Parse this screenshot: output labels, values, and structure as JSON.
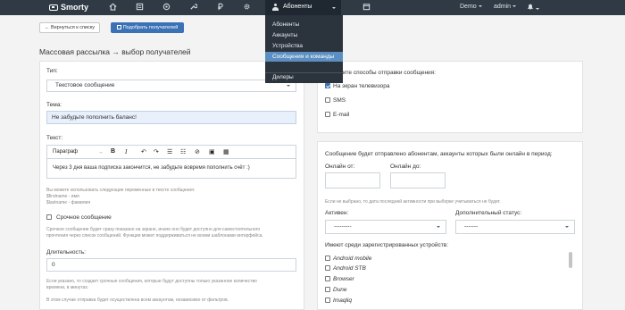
{
  "navbar": {
    "brand": "Smorty",
    "active_menu": "Абоненты",
    "demo": "Demo",
    "admin": "admin",
    "icons": [
      "home-icon",
      "list-icon",
      "eye-icon",
      "wrench-icon",
      "ruble-icon",
      "gear-icon",
      "calendar-icon",
      "bell-icon"
    ]
  },
  "dropdown": {
    "items": [
      "Абоненты",
      "Аккаунты",
      "Устройства",
      "Сообщения и команды",
      "Дилеры"
    ],
    "active": "Сообщения и команды"
  },
  "actions": {
    "back": "← Вернуться к списку",
    "pick": "Подобрать получателей"
  },
  "page": {
    "title": "Массовая рассылка → выбор получателей"
  },
  "form": {
    "type_label": "Тип:",
    "type_value": "Текстовое сообщение",
    "subject_label": "Тема:",
    "subject_value": "Не забудьте пополнить баланс!",
    "text_label": "Текст:",
    "editor_format": "Параграф",
    "editor_text": "Через 3 дня ваша подписка закончится, не забудьте вовремя пополнить счёт :)",
    "vars_help_1": "Вы можете использовать следующие переменные в тексте сообщения:",
    "vars_help_2": "$firstname - имя",
    "vars_help_3": "$lastname - фамилия",
    "urgent_label": "Срочное сообщение",
    "urgent_help_1": "Срочное сообщение будет сразу показано на экране, иначе оно будет доступно для самостоятельного",
    "urgent_help_2": "прочтения через список сообщений. Функция может поддерживаться не всеми шаблонами интерфейса.",
    "duration_label": "Длительность:",
    "duration_value": "0",
    "duration_help_1": "Если указано, то создает срочные сообщения, которые будут доступны только указанное количество",
    "duration_help_2": "времени, в минутах.",
    "duration_help_3": "В этом случае отправка будет осуществлена всем аккаунтам, независимо от фильтров."
  },
  "delivery": {
    "title": "Выберите способы отправки сообщения:",
    "methods": [
      {
        "label": "На экран телевизора",
        "checked": true
      },
      {
        "label": "SMS",
        "checked": false
      },
      {
        "label": "E-mail",
        "checked": false
      }
    ]
  },
  "period": {
    "title": "Сообщение будет отправлено абонентам, аккаунты которых были онлайн в период:",
    "from_label": "Онлайн от:",
    "to_label": "Онлайн до:",
    "help": "Если не выбрано, то дата последней активности при выборке учитываться не будет.",
    "active_label": "Активен:",
    "active_value": "---------",
    "status_label": "Дополнительный статус:",
    "status_value": "-------",
    "devices_label": "Имеют среди зарегистрированных устройств:",
    "devices": [
      "Android mobile",
      "Android STB",
      "Browser",
      "Dune",
      "Imaqliq"
    ]
  }
}
